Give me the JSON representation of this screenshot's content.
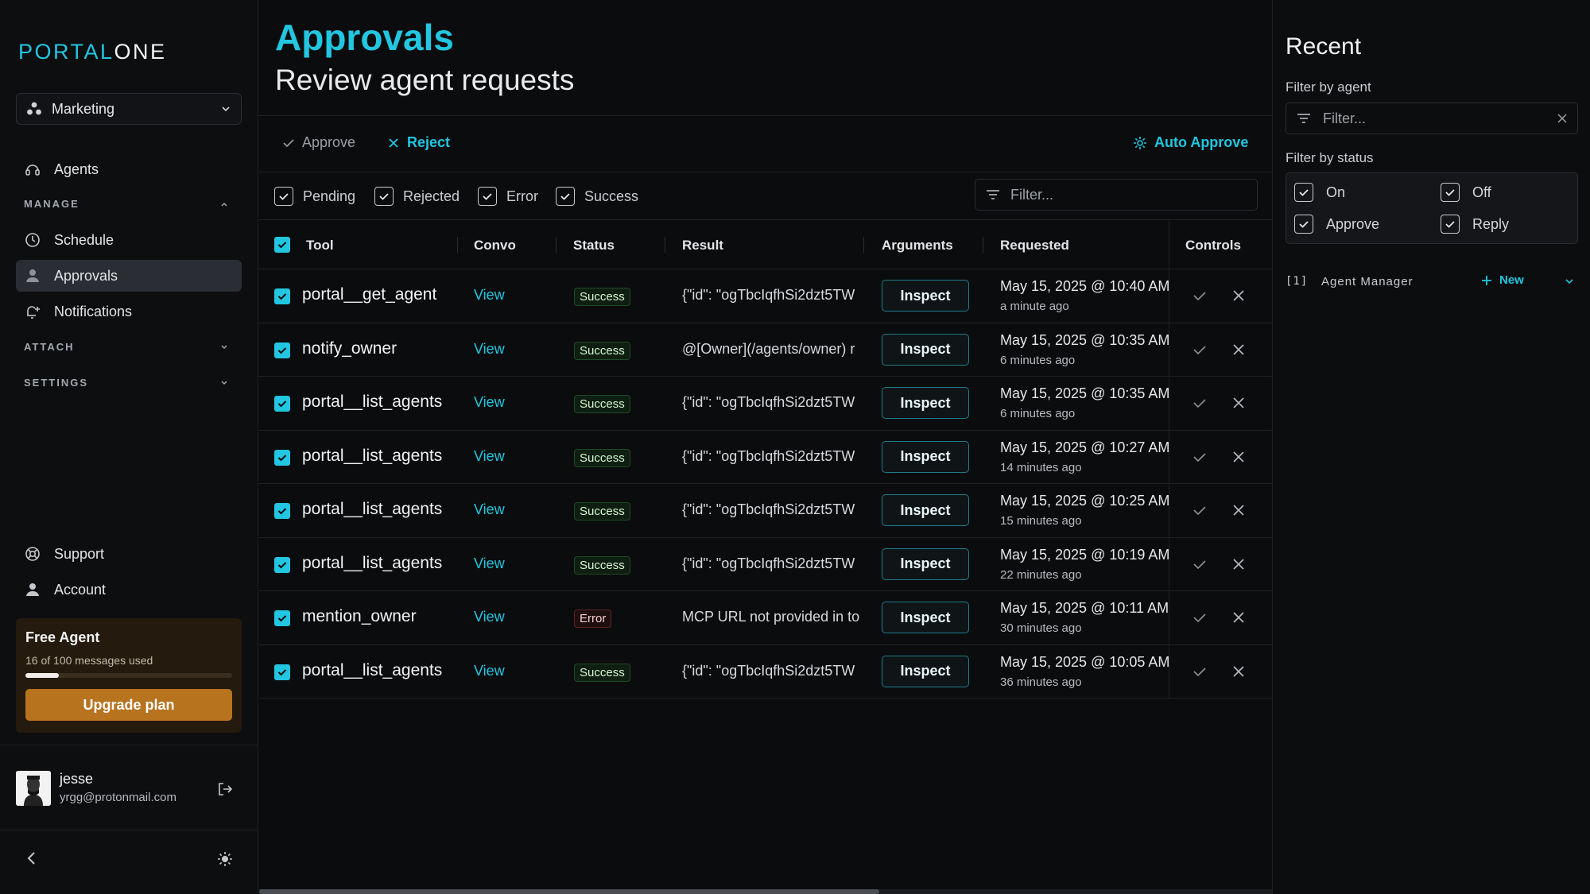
{
  "brand": {
    "part1": "PORTAL",
    "part2": "ONE"
  },
  "sidebar": {
    "workspace": "Marketing",
    "nav": {
      "agents": "Agents",
      "manage_header": "MANAGE",
      "schedule": "Schedule",
      "approvals": "Approvals",
      "notifications": "Notifications",
      "attach_header": "ATTACH",
      "settings_header": "SETTINGS",
      "support": "Support",
      "account": "Account"
    },
    "plan": {
      "title": "Free Agent",
      "usage": "16 of 100 messages used",
      "used": 16,
      "limit": 100,
      "upgrade": "Upgrade plan"
    },
    "user": {
      "name": "jesse",
      "email": "yrgg@protonmail.com"
    }
  },
  "page": {
    "title": "Approvals",
    "subtitle": "Review agent requests"
  },
  "toolbar": {
    "approve": "Approve",
    "reject": "Reject",
    "auto_approve": "Auto Approve"
  },
  "filters": {
    "pending": "Pending",
    "rejected": "Rejected",
    "error": "Error",
    "success": "Success",
    "placeholder": "Filter..."
  },
  "table": {
    "columns": {
      "tool": "Tool",
      "convo": "Convo",
      "status": "Status",
      "result": "Result",
      "arguments": "Arguments",
      "requested": "Requested",
      "controls": "Controls"
    },
    "rows": [
      {
        "tool": "portal__get_agent",
        "convo": "View",
        "status": "Success",
        "result": "{\"id\": \"ogTbcIqfhSi2dzt5TW",
        "args": "Inspect",
        "requested": "May 15, 2025 @ 10:40 AM",
        "ago": "a minute ago"
      },
      {
        "tool": "notify_owner",
        "convo": "View",
        "status": "Success",
        "result": "@[Owner](/agents/owner) r",
        "args": "Inspect",
        "requested": "May 15, 2025 @ 10:35 AM",
        "ago": "6 minutes ago"
      },
      {
        "tool": "portal__list_agents",
        "convo": "View",
        "status": "Success",
        "result": "{\"id\": \"ogTbcIqfhSi2dzt5TW",
        "args": "Inspect",
        "requested": "May 15, 2025 @ 10:35 AM",
        "ago": "6 minutes ago"
      },
      {
        "tool": "portal__list_agents",
        "convo": "View",
        "status": "Success",
        "result": "{\"id\": \"ogTbcIqfhSi2dzt5TW",
        "args": "Inspect",
        "requested": "May 15, 2025 @ 10:27 AM",
        "ago": "14 minutes ago"
      },
      {
        "tool": "portal__list_agents",
        "convo": "View",
        "status": "Success",
        "result": "{\"id\": \"ogTbcIqfhSi2dzt5TW",
        "args": "Inspect",
        "requested": "May 15, 2025 @ 10:25 AM",
        "ago": "15 minutes ago"
      },
      {
        "tool": "portal__list_agents",
        "convo": "View",
        "status": "Success",
        "result": "{\"id\": \"ogTbcIqfhSi2dzt5TW",
        "args": "Inspect",
        "requested": "May 15, 2025 @ 10:19 AM",
        "ago": "22 minutes ago"
      },
      {
        "tool": "mention_owner",
        "convo": "View",
        "status": "Error",
        "result": "MCP URL not provided in to",
        "args": "Inspect",
        "requested": "May 15, 2025 @ 10:11 AM",
        "ago": "30 minutes ago"
      },
      {
        "tool": "portal__list_agents",
        "convo": "View",
        "status": "Success",
        "result": "{\"id\": \"ogTbcIqfhSi2dzt5TW",
        "args": "Inspect",
        "requested": "May 15, 2025 @ 10:05 AM",
        "ago": "36 minutes ago"
      }
    ]
  },
  "right": {
    "title": "Recent",
    "filter_agent_label": "Filter by agent",
    "filter_placeholder": "Filter...",
    "filter_status_label": "Filter by status",
    "status": {
      "on": "On",
      "off": "Off",
      "approve": "Approve",
      "reply": "Reply"
    },
    "agent": {
      "index": "[1]",
      "name": "Agent Manager",
      "new": "New"
    }
  },
  "colors": {
    "accent": "#22c6e0",
    "success": "#1f4a26",
    "error": "#5a2524",
    "plan": "#b8731f"
  }
}
